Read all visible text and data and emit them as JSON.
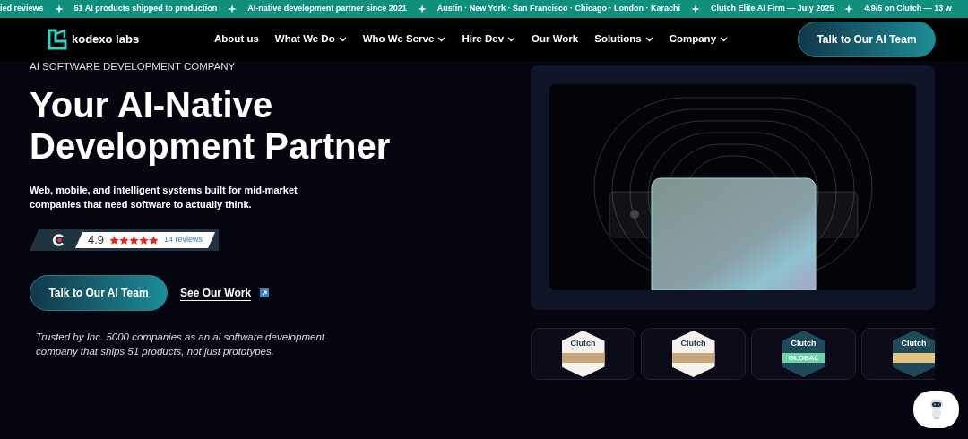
{
  "ticker": [
    "ied reviews",
    "51 AI products shipped to production",
    "AI-native development partner since 2021",
    "Austin · New York · San Francisco · Chicago · London · Karachi",
    "Clutch Elite AI Firm — July 2025",
    "4.9/5 on Clutch — 13 w"
  ],
  "nav": {
    "logo": "kodexo labs",
    "links": [
      {
        "label": "About us",
        "dropdown": false
      },
      {
        "label": "What We Do",
        "dropdown": true
      },
      {
        "label": "Who We Serve",
        "dropdown": true
      },
      {
        "label": "Hire Dev",
        "dropdown": true
      },
      {
        "label": "Our Work",
        "dropdown": false
      },
      {
        "label": "Solutions",
        "dropdown": true
      },
      {
        "label": "Company",
        "dropdown": true
      }
    ],
    "cta": "Talk to Our AI Team"
  },
  "hero": {
    "eyebrow": "AI SOFTWARE DEVELOPMENT COMPANY",
    "title_lines": [
      "Your AI-Native",
      "Development Partner"
    ],
    "subtitle": "Web, mobile, and intelligent systems built for mid-market companies that need software to actually think.",
    "rating": {
      "score": "4.9",
      "stars": 5,
      "reviews": "14 reviews"
    },
    "primary_button": "Talk to Our AI Team",
    "secondary_link": "See Our Work",
    "trust": "Trusted by Inc. 5000 companies as an ai software development company that ships 51 products, not just prototypes."
  },
  "badges": [
    {
      "kind": "light",
      "brand": "Clutch"
    },
    {
      "kind": "light",
      "brand": "Clutch"
    },
    {
      "kind": "ribbon",
      "brand": "Clutch",
      "ribbon": "GLOBAL"
    },
    {
      "kind": "gold",
      "brand": "Clutch"
    }
  ]
}
